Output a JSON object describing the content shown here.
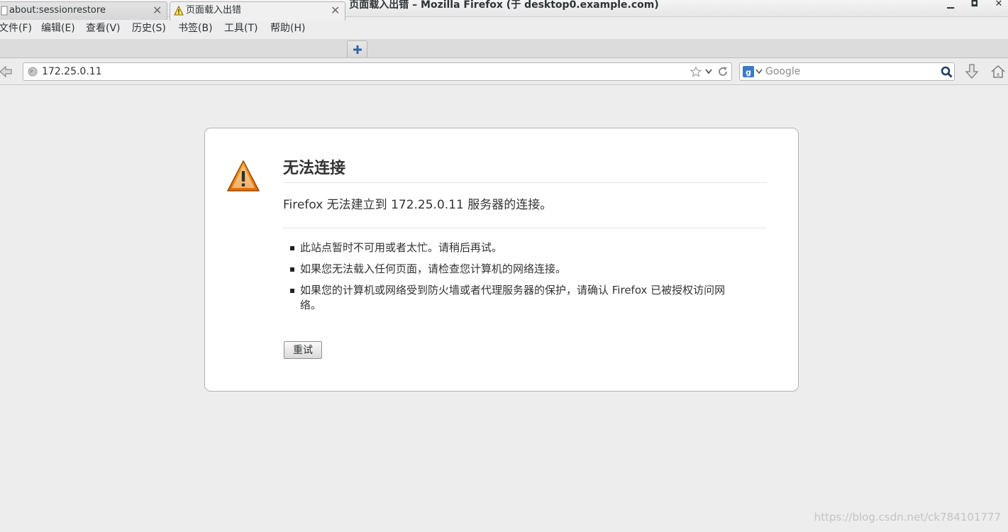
{
  "window": {
    "title": "页面载入出错 – Mozilla Firefox (于 desktop0.example.com)",
    "minimize_glyph": "▁",
    "maximize_glyph": "◘",
    "close_glyph": "✕"
  },
  "menubar": {
    "items": [
      {
        "label": "文件(F)"
      },
      {
        "label": "编辑(E)"
      },
      {
        "label": "查看(V)"
      },
      {
        "label": "历史(S)"
      },
      {
        "label": "书签(B)"
      },
      {
        "label": "工具(T)"
      },
      {
        "label": "帮助(H)"
      }
    ]
  },
  "tabs": [
    {
      "label": "about:sessionrestore",
      "active": false,
      "icon": "page-icon"
    },
    {
      "label": "页面载入出错",
      "active": true,
      "icon": "warning-icon"
    }
  ],
  "tab_close_glyph": "✕",
  "navbar": {
    "url": "172.25.0.11",
    "search_placeholder": "Google"
  },
  "error": {
    "title": "无法连接",
    "description": "Firefox 无法建立到 172.25.0.11 服务器的连接。",
    "items": [
      "此站点暂时不可用或者太忙。请稍后再试。",
      "如果您无法载入任何页面，请检查您计算机的网络连接。",
      "如果您的计算机或网络受到防火墙或者代理服务器的保护，请确认 Firefox 已被授权访问网络。"
    ],
    "retry_label": "重试"
  },
  "watermark": "https://blog.csdn.net/ck784101777",
  "colors": {
    "accent_blue": "#3465a4",
    "warning_orange": "#f57900"
  }
}
